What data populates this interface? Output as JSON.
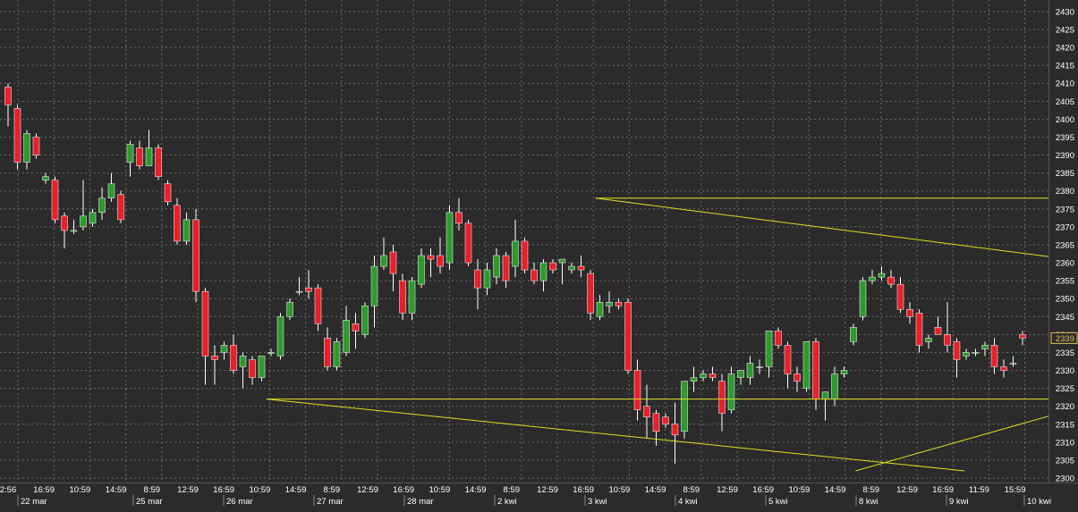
{
  "chart_data": {
    "type": "candlestick",
    "title": "",
    "xlabel": "",
    "ylabel": "",
    "ylim": [
      2298,
      2432
    ],
    "yticks": [
      2300,
      2305,
      2310,
      2315,
      2320,
      2325,
      2330,
      2335,
      2340,
      2345,
      2350,
      2355,
      2360,
      2365,
      2370,
      2375,
      2380,
      2385,
      2390,
      2395,
      2400,
      2405,
      2410,
      2415,
      2420,
      2425,
      2430
    ],
    "grid": true,
    "last_price": "2339",
    "time_labels": [
      "2:56",
      "16:59",
      "10:59",
      "14:59",
      "8:59",
      "12:59",
      "16:59",
      "10:59",
      "14:59",
      "8:59",
      "12:59",
      "16:59",
      "10:59",
      "14:59",
      "8:59",
      "12:59",
      "16:59",
      "10:59",
      "14:59",
      "8:59",
      "12:59",
      "16:59",
      "10:59",
      "14:59",
      "8:59",
      "12:59",
      "16:59",
      "11:59",
      "15:59"
    ],
    "date_labels": [
      "22 mar",
      "25 mar",
      "26 mar",
      "27 mar",
      "28 mar",
      "2 kwi",
      "3 kwi",
      "4 kwi",
      "5 kwi",
      "8 kwi",
      "9 kwi",
      "10 kwi"
    ],
    "candles": [
      {
        "o": 2409,
        "h": 2410,
        "l": 2398,
        "c": 2404
      },
      {
        "o": 2403,
        "h": 2404,
        "l": 2386,
        "c": 2388
      },
      {
        "o": 2388,
        "h": 2397,
        "l": 2386,
        "c": 2396
      },
      {
        "o": 2395,
        "h": 2396,
        "l": 2389,
        "c": 2390
      },
      {
        "o": 2383,
        "h": 2385,
        "l": 2382,
        "c": 2384
      },
      {
        "o": 2383,
        "h": 2384,
        "l": 2371,
        "c": 2372
      },
      {
        "o": 2373,
        "h": 2374,
        "l": 2364,
        "c": 2369
      },
      {
        "o": 2369,
        "h": 2372,
        "l": 2368,
        "c": 2369
      },
      {
        "o": 2370,
        "h": 2383,
        "l": 2369,
        "c": 2373
      },
      {
        "o": 2371,
        "h": 2375,
        "l": 2370,
        "c": 2374
      },
      {
        "o": 2374,
        "h": 2381,
        "l": 2372,
        "c": 2378
      },
      {
        "o": 2378,
        "h": 2385,
        "l": 2377,
        "c": 2382
      },
      {
        "o": 2379,
        "h": 2380,
        "l": 2371,
        "c": 2372
      },
      {
        "o": 2388,
        "h": 2394,
        "l": 2384,
        "c": 2393
      },
      {
        "o": 2392,
        "h": 2394,
        "l": 2386,
        "c": 2387
      },
      {
        "o": 2387,
        "h": 2397,
        "l": 2387,
        "c": 2392
      },
      {
        "o": 2392,
        "h": 2393,
        "l": 2383,
        "c": 2384
      },
      {
        "o": 2382,
        "h": 2383,
        "l": 2376,
        "c": 2377
      },
      {
        "o": 2376,
        "h": 2378,
        "l": 2365,
        "c": 2366
      },
      {
        "o": 2366,
        "h": 2374,
        "l": 2365,
        "c": 2372
      },
      {
        "o": 2372,
        "h": 2375,
        "l": 2349,
        "c": 2352
      },
      {
        "o": 2352,
        "h": 2353,
        "l": 2326,
        "c": 2334
      },
      {
        "o": 2334,
        "h": 2337,
        "l": 2326,
        "c": 2333
      },
      {
        "o": 2335,
        "h": 2338,
        "l": 2333,
        "c": 2337
      },
      {
        "o": 2337,
        "h": 2340,
        "l": 2329,
        "c": 2330
      },
      {
        "o": 2331,
        "h": 2335,
        "l": 2325,
        "c": 2334
      },
      {
        "o": 2333,
        "h": 2334,
        "l": 2326,
        "c": 2328
      },
      {
        "o": 2328,
        "h": 2334,
        "l": 2327,
        "c": 2334
      },
      {
        "o": 2335,
        "h": 2336,
        "l": 2334,
        "c": 2335
      },
      {
        "o": 2334,
        "h": 2346,
        "l": 2333,
        "c": 2345
      },
      {
        "o": 2345,
        "h": 2350,
        "l": 2344,
        "c": 2349
      },
      {
        "o": 2352,
        "h": 2356,
        "l": 2351,
        "c": 2352
      },
      {
        "o": 2353,
        "h": 2358,
        "l": 2350,
        "c": 2352
      },
      {
        "o": 2353,
        "h": 2354,
        "l": 2341,
        "c": 2343
      },
      {
        "o": 2339,
        "h": 2342,
        "l": 2330,
        "c": 2331
      },
      {
        "o": 2331,
        "h": 2339,
        "l": 2330,
        "c": 2338
      },
      {
        "o": 2335,
        "h": 2348,
        "l": 2334,
        "c": 2344
      },
      {
        "o": 2343,
        "h": 2346,
        "l": 2336,
        "c": 2341
      },
      {
        "o": 2340,
        "h": 2349,
        "l": 2339,
        "c": 2348
      },
      {
        "o": 2348,
        "h": 2362,
        "l": 2342,
        "c": 2359
      },
      {
        "o": 2359,
        "h": 2367,
        "l": 2358,
        "c": 2362
      },
      {
        "o": 2363,
        "h": 2365,
        "l": 2352,
        "c": 2357
      },
      {
        "o": 2355,
        "h": 2357,
        "l": 2344,
        "c": 2346
      },
      {
        "o": 2346,
        "h": 2356,
        "l": 2344,
        "c": 2355
      },
      {
        "o": 2354,
        "h": 2364,
        "l": 2353,
        "c": 2362
      },
      {
        "o": 2362,
        "h": 2364,
        "l": 2356,
        "c": 2361
      },
      {
        "o": 2362,
        "h": 2367,
        "l": 2357,
        "c": 2359
      },
      {
        "o": 2360,
        "h": 2376,
        "l": 2358,
        "c": 2374
      },
      {
        "o": 2374,
        "h": 2378,
        "l": 2369,
        "c": 2371
      },
      {
        "o": 2371,
        "h": 2372,
        "l": 2359,
        "c": 2360
      },
      {
        "o": 2358,
        "h": 2361,
        "l": 2347,
        "c": 2353
      },
      {
        "o": 2353,
        "h": 2360,
        "l": 2351,
        "c": 2358
      },
      {
        "o": 2356,
        "h": 2364,
        "l": 2354,
        "c": 2362
      },
      {
        "o": 2362,
        "h": 2363,
        "l": 2353,
        "c": 2355
      },
      {
        "o": 2359,
        "h": 2372,
        "l": 2356,
        "c": 2366
      },
      {
        "o": 2366,
        "h": 2367,
        "l": 2357,
        "c": 2358
      },
      {
        "o": 2358,
        "h": 2360,
        "l": 2354,
        "c": 2355
      },
      {
        "o": 2355,
        "h": 2361,
        "l": 2352,
        "c": 2360
      },
      {
        "o": 2360,
        "h": 2361,
        "l": 2357,
        "c": 2358
      },
      {
        "o": 2360,
        "h": 2361,
        "l": 2354,
        "c": 2361
      },
      {
        "o": 2358,
        "h": 2360,
        "l": 2357,
        "c": 2359
      },
      {
        "o": 2359,
        "h": 2362,
        "l": 2356,
        "c": 2358
      },
      {
        "o": 2357,
        "h": 2358,
        "l": 2344,
        "c": 2346
      },
      {
        "o": 2345,
        "h": 2351,
        "l": 2344,
        "c": 2349
      },
      {
        "o": 2348,
        "h": 2352,
        "l": 2346,
        "c": 2349
      },
      {
        "o": 2349,
        "h": 2350,
        "l": 2347,
        "c": 2348
      },
      {
        "o": 2349,
        "h": 2350,
        "l": 2329,
        "c": 2330
      },
      {
        "o": 2330,
        "h": 2333,
        "l": 2316,
        "c": 2319
      },
      {
        "o": 2320,
        "h": 2326,
        "l": 2311,
        "c": 2317
      },
      {
        "o": 2318,
        "h": 2319,
        "l": 2309,
        "c": 2313
      },
      {
        "o": 2317,
        "h": 2318,
        "l": 2314,
        "c": 2315
      },
      {
        "o": 2315,
        "h": 2321,
        "l": 2304,
        "c": 2312
      },
      {
        "o": 2313,
        "h": 2327,
        "l": 2311,
        "c": 2327
      },
      {
        "o": 2327,
        "h": 2331,
        "l": 2324,
        "c": 2328
      },
      {
        "o": 2328,
        "h": 2330,
        "l": 2327,
        "c": 2329
      },
      {
        "o": 2329,
        "h": 2331,
        "l": 2327,
        "c": 2328
      },
      {
        "o": 2327,
        "h": 2329,
        "l": 2313,
        "c": 2318
      },
      {
        "o": 2319,
        "h": 2331,
        "l": 2318,
        "c": 2329
      },
      {
        "o": 2328,
        "h": 2330,
        "l": 2326,
        "c": 2330
      },
      {
        "o": 2328,
        "h": 2334,
        "l": 2326,
        "c": 2332
      },
      {
        "o": 2331,
        "h": 2333,
        "l": 2329,
        "c": 2331
      },
      {
        "o": 2331,
        "h": 2340,
        "l": 2328,
        "c": 2341
      },
      {
        "o": 2341,
        "h": 2342,
        "l": 2336,
        "c": 2337
      },
      {
        "o": 2337,
        "h": 2338,
        "l": 2325,
        "c": 2329
      },
      {
        "o": 2329,
        "h": 2331,
        "l": 2324,
        "c": 2327
      },
      {
        "o": 2325,
        "h": 2338,
        "l": 2324,
        "c": 2338
      },
      {
        "o": 2338,
        "h": 2339,
        "l": 2319,
        "c": 2322
      },
      {
        "o": 2322,
        "h": 2324,
        "l": 2316,
        "c": 2324
      },
      {
        "o": 2322,
        "h": 2331,
        "l": 2320,
        "c": 2329
      },
      {
        "o": 2329,
        "h": 2331,
        "l": 2328,
        "c": 2330
      },
      {
        "o": 2338,
        "h": 2343,
        "l": 2337,
        "c": 2342
      },
      {
        "o": 2345,
        "h": 2356,
        "l": 2344,
        "c": 2355
      },
      {
        "o": 2355,
        "h": 2358,
        "l": 2354,
        "c": 2356
      },
      {
        "o": 2356,
        "h": 2359,
        "l": 2355,
        "c": 2357
      },
      {
        "o": 2356,
        "h": 2358,
        "l": 2353,
        "c": 2354
      },
      {
        "o": 2354,
        "h": 2356,
        "l": 2346,
        "c": 2347
      },
      {
        "o": 2347,
        "h": 2349,
        "l": 2343,
        "c": 2345
      },
      {
        "o": 2346,
        "h": 2347,
        "l": 2335,
        "c": 2337
      },
      {
        "o": 2338,
        "h": 2340,
        "l": 2336,
        "c": 2339
      },
      {
        "o": 2342,
        "h": 2345,
        "l": 2340,
        "c": 2340
      },
      {
        "o": 2340,
        "h": 2349,
        "l": 2335,
        "c": 2337
      },
      {
        "o": 2338,
        "h": 2339,
        "l": 2328,
        "c": 2333
      },
      {
        "o": 2334,
        "h": 2336,
        "l": 2333,
        "c": 2335
      },
      {
        "o": 2335,
        "h": 2336,
        "l": 2334,
        "c": 2335
      },
      {
        "o": 2336,
        "h": 2338,
        "l": 2334,
        "c": 2337
      },
      {
        "o": 2337,
        "h": 2339,
        "l": 2329,
        "c": 2331
      },
      {
        "o": 2331,
        "h": 2333,
        "l": 2328,
        "c": 2330
      },
      {
        "o": 2332,
        "h": 2334,
        "l": 2331,
        "c": 2332
      },
      {
        "o": 2340,
        "h": 2341,
        "l": 2337,
        "c": 2339
      }
    ],
    "trendlines": [
      {
        "x1": 56.8,
        "y1": 2378,
        "x2": 117.8,
        "y2": 2378
      },
      {
        "x1": 56.8,
        "y1": 2378,
        "x2": 117.8,
        "y2": 2355
      },
      {
        "x1": 103.7,
        "y1": 2362,
        "x2": 117.8,
        "y2": 2362
      },
      {
        "x1": 103.7,
        "y1": 2362,
        "x2": 117.8,
        "y2": 2355
      },
      {
        "x1": 25.4,
        "y1": 2322,
        "x2": 117.8,
        "y2": 2322
      },
      {
        "x1": 25.4,
        "y1": 2322,
        "x2": 92.0,
        "y2": 2302
      },
      {
        "x1": 81.6,
        "y1": 2302,
        "x2": 117.8,
        "y2": 2332
      }
    ],
    "colors": {
      "background": "#2b2b2b",
      "up": "#2e9a2e",
      "down": "#e8202a",
      "wick": "#ffffff",
      "trendline": "#e0e020",
      "grid": "#6a6a6a",
      "text": "#ffffff"
    }
  }
}
